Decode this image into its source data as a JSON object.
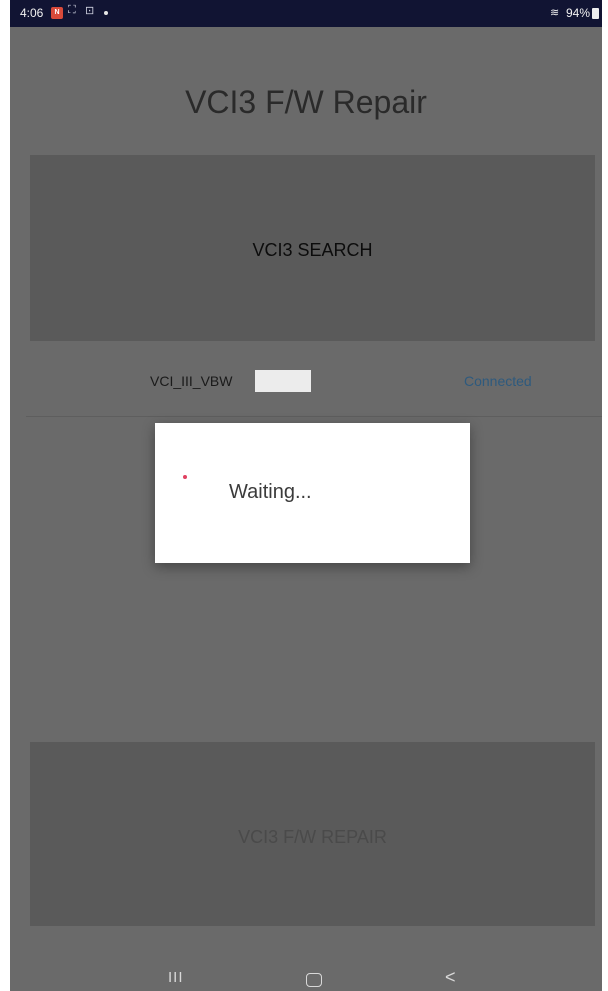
{
  "status_bar": {
    "time": "4:06",
    "battery": "94%",
    "calendar_date": "N",
    "wifi_icon": "wifi-icon",
    "battery_icon": "battery-icon"
  },
  "title": "VCI3 F/W Repair",
  "search_button": {
    "label": "VCI3 SEARCH"
  },
  "device": {
    "name": "VCI_III_VBW",
    "status": "Connected"
  },
  "dialog": {
    "message": "Waiting..."
  },
  "repair_button": {
    "label": "VCI3 F/W REPAIR"
  },
  "nav": {
    "recents": "III",
    "back": "<"
  },
  "colors": {
    "overlay": "#6a6a6a",
    "status_bar": "#111433",
    "connected": "#2e5a7e"
  }
}
